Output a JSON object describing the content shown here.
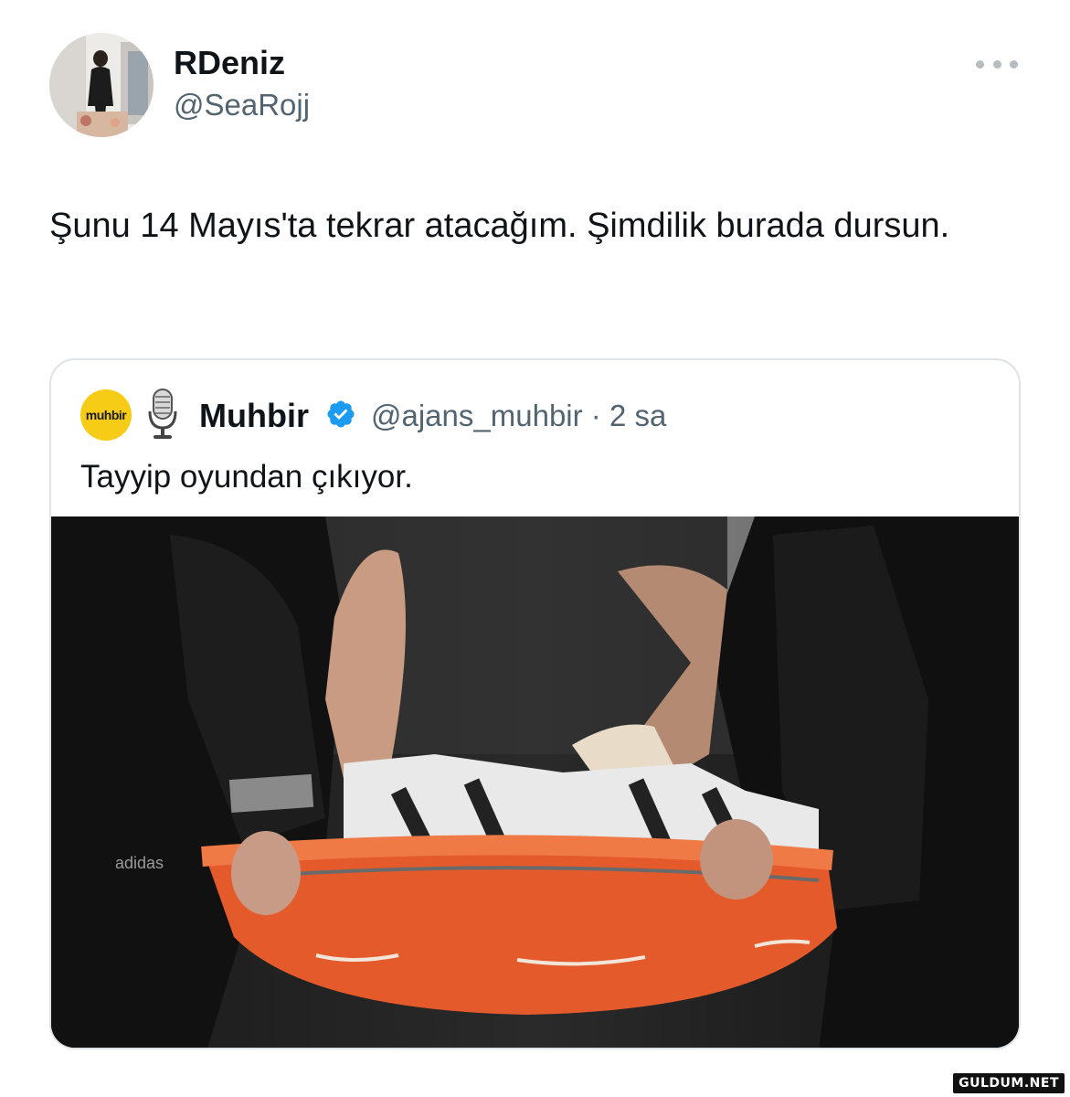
{
  "author": {
    "name": "RDeniz",
    "handle": "@SeaRojj"
  },
  "tweet": {
    "text": "Şunu 14 Mayıs'ta tekrar atacağım. Şimdilik burada dursun."
  },
  "quoted_tweet": {
    "logo_text": "muhbir",
    "name": "Muhbir",
    "handle": "@ajans_muhbir",
    "separator": "·",
    "time": "2 sa",
    "text": "Tayyip oyundan çıkıyor.",
    "image_brand_text": "adidas"
  },
  "icons": {
    "more": "more-horizontal-icon",
    "verified": "verified-badge-icon",
    "mic": "microphone-icon"
  },
  "colors": {
    "text": "#0f1419",
    "secondary": "#536471",
    "verified": "#1d9bf0",
    "logo_bg": "#f7cc16",
    "stretcher": "#e55a2b"
  },
  "watermark": "GULDUM.NET"
}
